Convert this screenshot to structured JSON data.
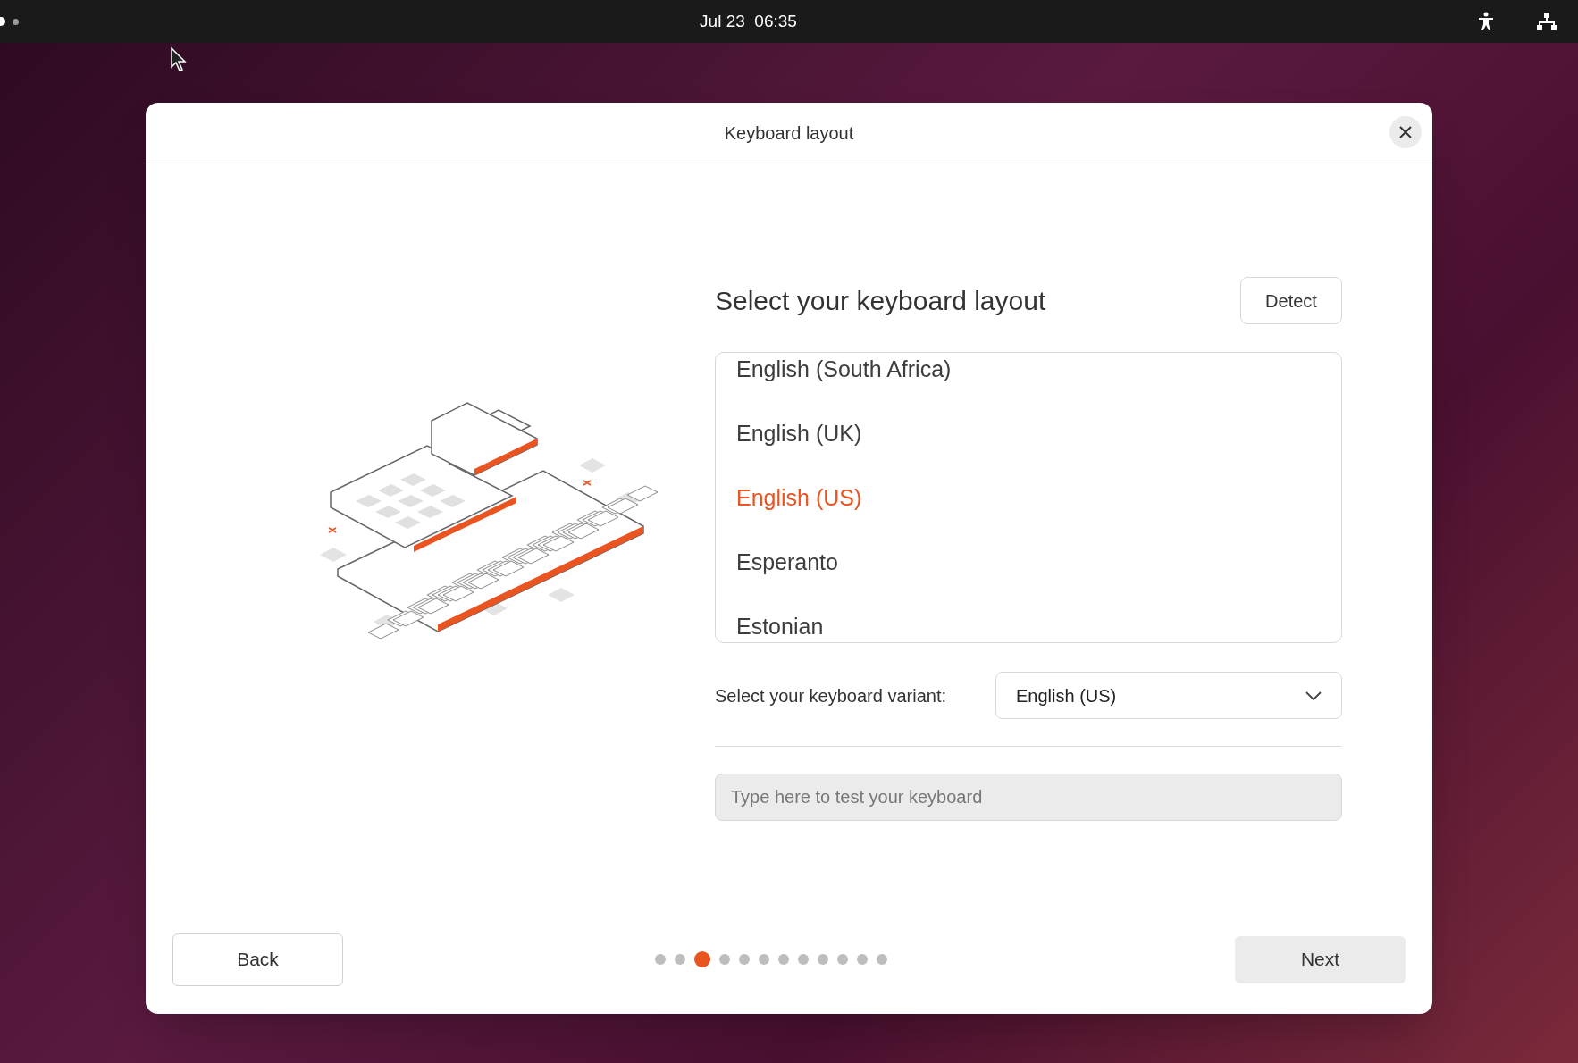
{
  "top_bar": {
    "clock": "Jul 23  06:35",
    "workspaces": [
      {
        "selected": true
      },
      {
        "selected": false
      }
    ]
  },
  "dialog": {
    "title": "Keyboard layout",
    "heading": "Select your keyboard layout",
    "detect_button": "Detect",
    "layouts": [
      {
        "label": "English (South Africa)",
        "selected": false
      },
      {
        "label": "English (UK)",
        "selected": false
      },
      {
        "label": "English (US)",
        "selected": true
      },
      {
        "label": "Esperanto",
        "selected": false
      },
      {
        "label": "Estonian",
        "selected": false
      }
    ],
    "variant_label": "Select your keyboard variant:",
    "variant_value": "English (US)",
    "test_field": {
      "placeholder": "Type here to test your keyboard"
    },
    "back_button": "Back",
    "next_button": "Next",
    "steps": [
      {
        "selected": false
      },
      {
        "selected": false
      },
      {
        "selected": true
      },
      {
        "selected": false
      },
      {
        "selected": false
      },
      {
        "selected": false
      },
      {
        "selected": false
      },
      {
        "selected": false
      },
      {
        "selected": false
      },
      {
        "selected": false
      },
      {
        "selected": false
      },
      {
        "selected": false
      }
    ]
  }
}
